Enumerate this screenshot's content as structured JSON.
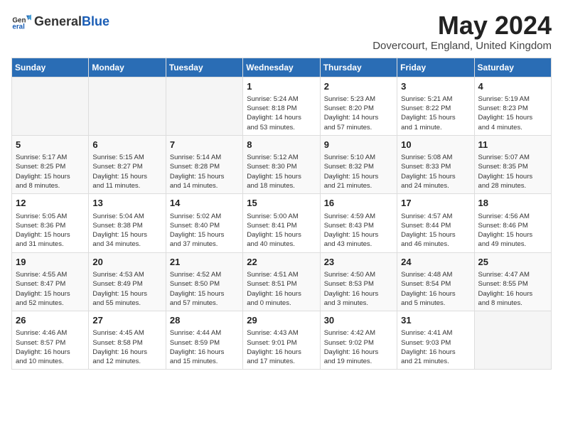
{
  "header": {
    "logo_general": "General",
    "logo_blue": "Blue",
    "title": "May 2024",
    "location": "Dovercourt, England, United Kingdom"
  },
  "days_of_week": [
    "Sunday",
    "Monday",
    "Tuesday",
    "Wednesday",
    "Thursday",
    "Friday",
    "Saturday"
  ],
  "weeks": [
    [
      {
        "day": "",
        "info": ""
      },
      {
        "day": "",
        "info": ""
      },
      {
        "day": "",
        "info": ""
      },
      {
        "day": "1",
        "info": "Sunrise: 5:24 AM\nSunset: 8:18 PM\nDaylight: 14 hours\nand 53 minutes."
      },
      {
        "day": "2",
        "info": "Sunrise: 5:23 AM\nSunset: 8:20 PM\nDaylight: 14 hours\nand 57 minutes."
      },
      {
        "day": "3",
        "info": "Sunrise: 5:21 AM\nSunset: 8:22 PM\nDaylight: 15 hours\nand 1 minute."
      },
      {
        "day": "4",
        "info": "Sunrise: 5:19 AM\nSunset: 8:23 PM\nDaylight: 15 hours\nand 4 minutes."
      }
    ],
    [
      {
        "day": "5",
        "info": "Sunrise: 5:17 AM\nSunset: 8:25 PM\nDaylight: 15 hours\nand 8 minutes."
      },
      {
        "day": "6",
        "info": "Sunrise: 5:15 AM\nSunset: 8:27 PM\nDaylight: 15 hours\nand 11 minutes."
      },
      {
        "day": "7",
        "info": "Sunrise: 5:14 AM\nSunset: 8:28 PM\nDaylight: 15 hours\nand 14 minutes."
      },
      {
        "day": "8",
        "info": "Sunrise: 5:12 AM\nSunset: 8:30 PM\nDaylight: 15 hours\nand 18 minutes."
      },
      {
        "day": "9",
        "info": "Sunrise: 5:10 AM\nSunset: 8:32 PM\nDaylight: 15 hours\nand 21 minutes."
      },
      {
        "day": "10",
        "info": "Sunrise: 5:08 AM\nSunset: 8:33 PM\nDaylight: 15 hours\nand 24 minutes."
      },
      {
        "day": "11",
        "info": "Sunrise: 5:07 AM\nSunset: 8:35 PM\nDaylight: 15 hours\nand 28 minutes."
      }
    ],
    [
      {
        "day": "12",
        "info": "Sunrise: 5:05 AM\nSunset: 8:36 PM\nDaylight: 15 hours\nand 31 minutes."
      },
      {
        "day": "13",
        "info": "Sunrise: 5:04 AM\nSunset: 8:38 PM\nDaylight: 15 hours\nand 34 minutes."
      },
      {
        "day": "14",
        "info": "Sunrise: 5:02 AM\nSunset: 8:40 PM\nDaylight: 15 hours\nand 37 minutes."
      },
      {
        "day": "15",
        "info": "Sunrise: 5:00 AM\nSunset: 8:41 PM\nDaylight: 15 hours\nand 40 minutes."
      },
      {
        "day": "16",
        "info": "Sunrise: 4:59 AM\nSunset: 8:43 PM\nDaylight: 15 hours\nand 43 minutes."
      },
      {
        "day": "17",
        "info": "Sunrise: 4:57 AM\nSunset: 8:44 PM\nDaylight: 15 hours\nand 46 minutes."
      },
      {
        "day": "18",
        "info": "Sunrise: 4:56 AM\nSunset: 8:46 PM\nDaylight: 15 hours\nand 49 minutes."
      }
    ],
    [
      {
        "day": "19",
        "info": "Sunrise: 4:55 AM\nSunset: 8:47 PM\nDaylight: 15 hours\nand 52 minutes."
      },
      {
        "day": "20",
        "info": "Sunrise: 4:53 AM\nSunset: 8:49 PM\nDaylight: 15 hours\nand 55 minutes."
      },
      {
        "day": "21",
        "info": "Sunrise: 4:52 AM\nSunset: 8:50 PM\nDaylight: 15 hours\nand 57 minutes."
      },
      {
        "day": "22",
        "info": "Sunrise: 4:51 AM\nSunset: 8:51 PM\nDaylight: 16 hours\nand 0 minutes."
      },
      {
        "day": "23",
        "info": "Sunrise: 4:50 AM\nSunset: 8:53 PM\nDaylight: 16 hours\nand 3 minutes."
      },
      {
        "day": "24",
        "info": "Sunrise: 4:48 AM\nSunset: 8:54 PM\nDaylight: 16 hours\nand 5 minutes."
      },
      {
        "day": "25",
        "info": "Sunrise: 4:47 AM\nSunset: 8:55 PM\nDaylight: 16 hours\nand 8 minutes."
      }
    ],
    [
      {
        "day": "26",
        "info": "Sunrise: 4:46 AM\nSunset: 8:57 PM\nDaylight: 16 hours\nand 10 minutes."
      },
      {
        "day": "27",
        "info": "Sunrise: 4:45 AM\nSunset: 8:58 PM\nDaylight: 16 hours\nand 12 minutes."
      },
      {
        "day": "28",
        "info": "Sunrise: 4:44 AM\nSunset: 8:59 PM\nDaylight: 16 hours\nand 15 minutes."
      },
      {
        "day": "29",
        "info": "Sunrise: 4:43 AM\nSunset: 9:01 PM\nDaylight: 16 hours\nand 17 minutes."
      },
      {
        "day": "30",
        "info": "Sunrise: 4:42 AM\nSunset: 9:02 PM\nDaylight: 16 hours\nand 19 minutes."
      },
      {
        "day": "31",
        "info": "Sunrise: 4:41 AM\nSunset: 9:03 PM\nDaylight: 16 hours\nand 21 minutes."
      },
      {
        "day": "",
        "info": ""
      }
    ]
  ]
}
